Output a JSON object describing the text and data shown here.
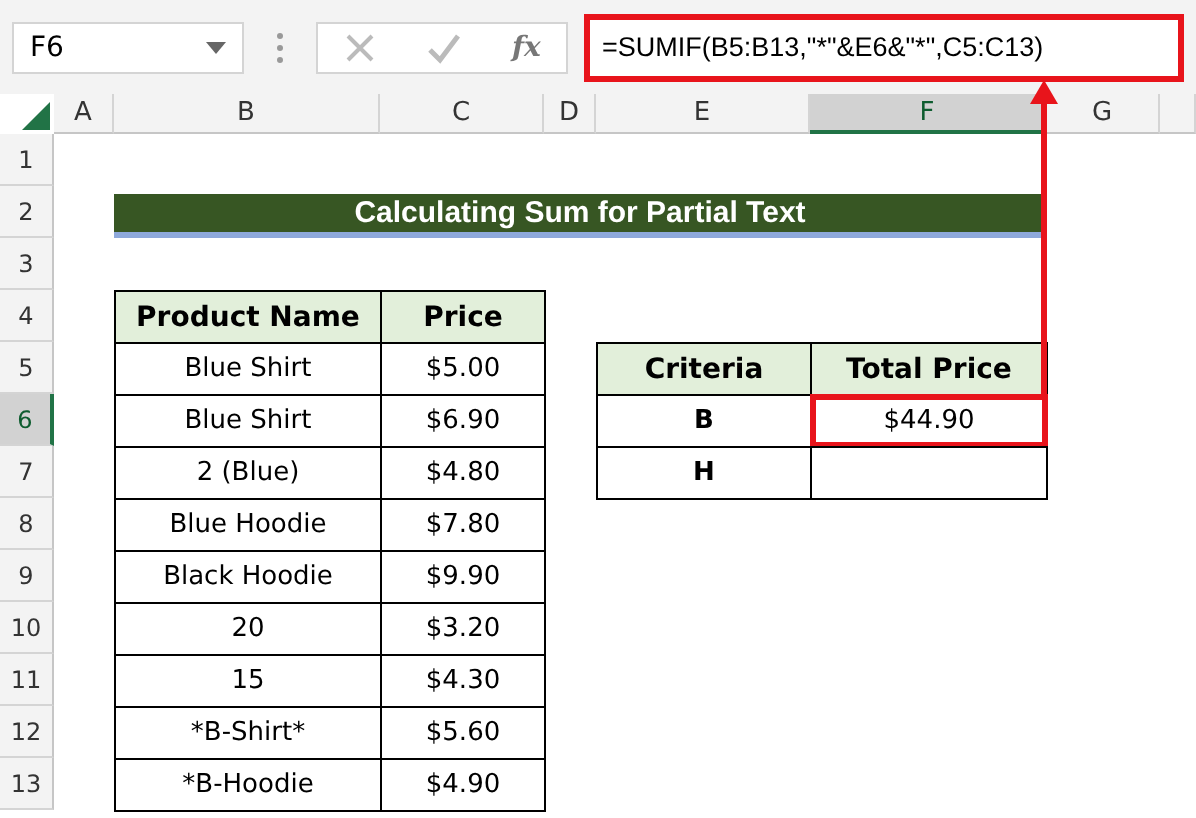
{
  "name_box": "F6",
  "formula_bar": {
    "fx": "fx",
    "formula": "=SUMIF(B5:B13,\"*\"&E6&\"*\",C5:C13)",
    "highlighted": true
  },
  "column_headers": [
    {
      "label": "A",
      "selected": false
    },
    {
      "label": "B",
      "selected": false
    },
    {
      "label": "C",
      "selected": false
    },
    {
      "label": "D",
      "selected": false
    },
    {
      "label": "E",
      "selected": false
    },
    {
      "label": "F",
      "selected": true
    },
    {
      "label": "G",
      "selected": false
    }
  ],
  "row_headers": [
    {
      "label": "1",
      "selected": false
    },
    {
      "label": "2",
      "selected": false
    },
    {
      "label": "3",
      "selected": false
    },
    {
      "label": "4",
      "selected": false
    },
    {
      "label": "5",
      "selected": false
    },
    {
      "label": "6",
      "selected": true
    },
    {
      "label": "7",
      "selected": false
    },
    {
      "label": "8",
      "selected": false
    },
    {
      "label": "9",
      "selected": false
    },
    {
      "label": "10",
      "selected": false
    },
    {
      "label": "11",
      "selected": false
    },
    {
      "label": "12",
      "selected": false
    },
    {
      "label": "13",
      "selected": false
    }
  ],
  "title": "Calculating Sum for Partial Text",
  "products": {
    "columns": [
      "Product Name",
      "Price"
    ],
    "rows": [
      [
        "Blue Shirt",
        "$5.00"
      ],
      [
        "Blue Shirt",
        "$6.90"
      ],
      [
        "2 (Blue)",
        "$4.80"
      ],
      [
        "Blue Hoodie",
        "$7.80"
      ],
      [
        "Black Hoodie",
        "$9.90"
      ],
      [
        "20",
        "$3.20"
      ],
      [
        "15",
        "$4.30"
      ],
      [
        "*B-Shirt*",
        "$5.60"
      ],
      [
        "*B-Hoodie",
        "$4.90"
      ]
    ]
  },
  "summary": {
    "columns": [
      "Criteria",
      "Total Price"
    ],
    "rows": [
      {
        "criteria": "B",
        "total": "$44.90",
        "highlighted": true
      },
      {
        "criteria": "H",
        "highlighted": false
      }
    ]
  }
}
